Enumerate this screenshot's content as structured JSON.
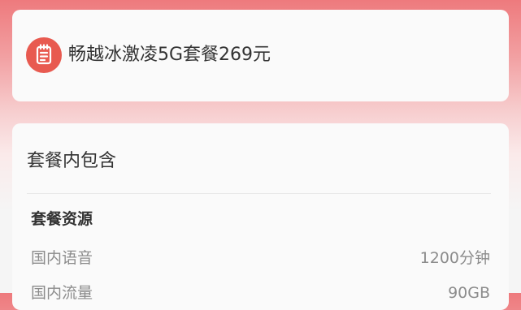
{
  "plan": {
    "icon": "document-icon",
    "name": "畅越冰激凌5G套餐269元"
  },
  "details": {
    "section_title": "套餐内包含",
    "group_title": "套餐资源",
    "resources": [
      {
        "label": "国内语音",
        "value": "1200分钟"
      },
      {
        "label": "国内流量",
        "value": "90GB"
      }
    ]
  },
  "colors": {
    "accent": "#e85a50",
    "header_gradient_top": "#ee7a7d",
    "text_primary": "#333333",
    "text_secondary": "#8c8c8c"
  }
}
